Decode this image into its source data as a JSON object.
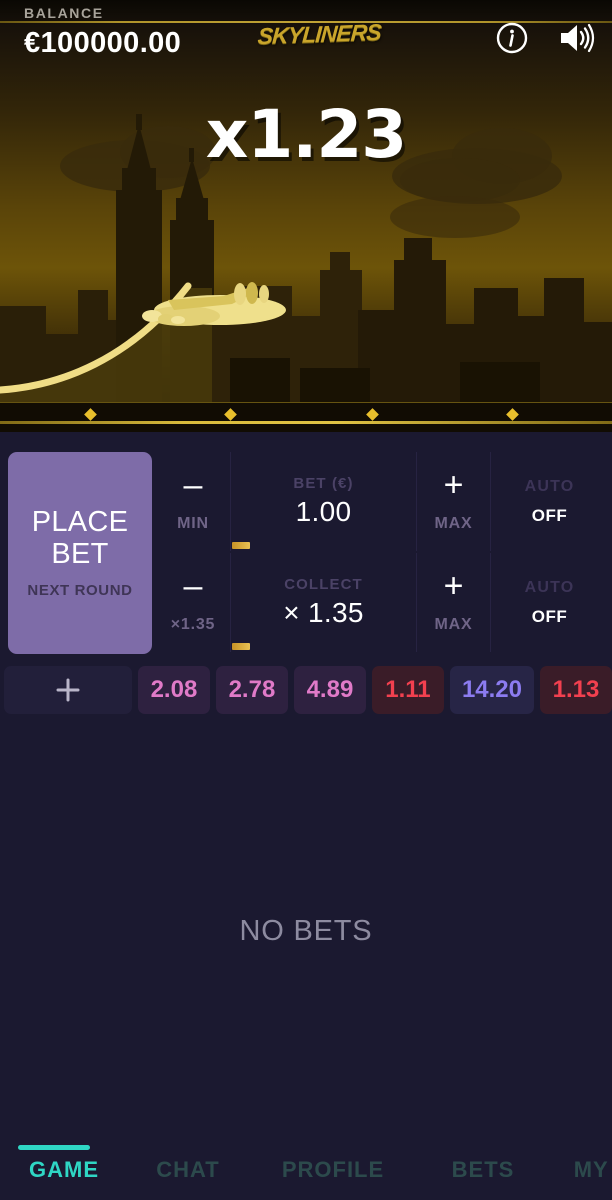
{
  "header": {
    "balance_label": "BALANCE",
    "balance_value": "€100000.00",
    "brand": "SKYLINERS",
    "info_icon": "info-circle-icon",
    "sound_icon": "speaker-on-icon"
  },
  "game": {
    "multiplier": "x1.23",
    "state": "in-flight",
    "plane_icon": "airplane-icon",
    "axis_markers": [
      90,
      230,
      372,
      512
    ]
  },
  "panel": {
    "place_bet": {
      "main": "PLACE\nBET",
      "line1": "PLACE",
      "line2": "BET",
      "sub": "NEXT ROUND"
    },
    "bet_row": {
      "minus_sign": "–",
      "minus_label": "MIN",
      "field_label": "BET (€)",
      "field_value": "1.00",
      "plus_sign": "+",
      "plus_label": "MAX",
      "auto_label": "AUTO",
      "auto_state": "OFF"
    },
    "collect_row": {
      "minus_sign": "–",
      "minus_label": "×1.35",
      "field_label": "COLLECT",
      "field_value": "× 1.35",
      "plus_sign": "+",
      "plus_label": "MAX",
      "auto_label": "AUTO",
      "auto_state": "OFF"
    }
  },
  "history": {
    "add_icon": "plus-icon",
    "chips": [
      {
        "value": "2.08",
        "color": "pink"
      },
      {
        "value": "2.78",
        "color": "pink"
      },
      {
        "value": "4.89",
        "color": "pink"
      },
      {
        "value": "1.11",
        "color": "red"
      },
      {
        "value": "14.20",
        "color": "blue"
      },
      {
        "value": "1.13",
        "color": "red"
      }
    ]
  },
  "bets": {
    "empty_text": "NO BETS"
  },
  "nav": {
    "items": [
      {
        "label": "GAME",
        "active": true
      },
      {
        "label": "CHAT",
        "active": false
      },
      {
        "label": "PROFILE",
        "active": false
      },
      {
        "label": "BETS",
        "active": false
      },
      {
        "label": "MY B",
        "active": false
      }
    ]
  },
  "colors": {
    "accent_teal": "#2fd6c4",
    "place_bet_purple": "#7e6ca8",
    "gold": "#e0c344",
    "panel_bg": "#1b1930",
    "chip_pink": "#e07ac8",
    "chip_red": "#f2404f",
    "chip_blue": "#8c7cf0"
  }
}
